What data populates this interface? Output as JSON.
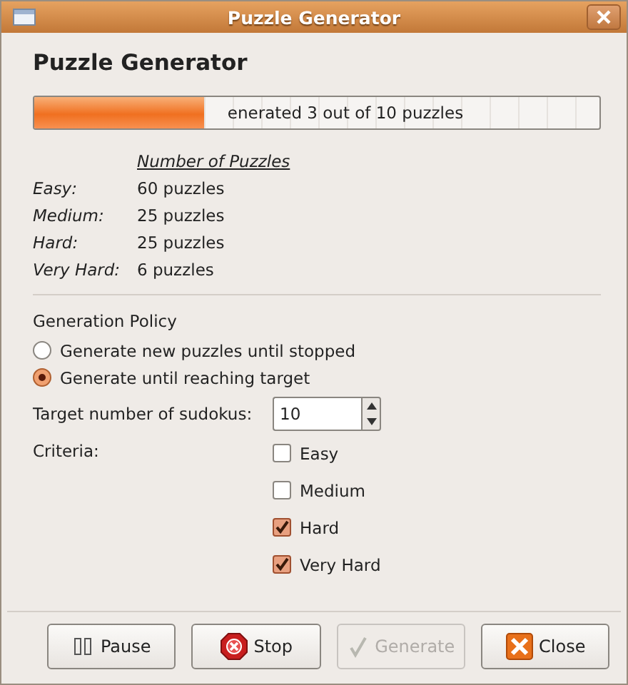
{
  "window": {
    "title": "Puzzle Generator"
  },
  "heading": "Puzzle Generator",
  "progress": {
    "level": 0.3,
    "text": "enerated 3 out of 10 puzzles"
  },
  "counts": {
    "header": "Number of Puzzles",
    "rows": [
      {
        "label": "Easy:",
        "value": "60 puzzles"
      },
      {
        "label": "Medium:",
        "value": "25 puzzles"
      },
      {
        "label": "Hard:",
        "value": "25 puzzles"
      },
      {
        "label": "Very Hard:",
        "value": "6 puzzles"
      }
    ]
  },
  "policy": {
    "title": "Generation Policy",
    "options": [
      {
        "label": "Generate new puzzles until stopped",
        "selected": false
      },
      {
        "label": "Generate until reaching target",
        "selected": true
      }
    ]
  },
  "target": {
    "label": "Target number of sudokus:",
    "value": "10"
  },
  "criteria": {
    "label": "Criteria:",
    "items": [
      {
        "label": "Easy",
        "checked": false
      },
      {
        "label": "Medium",
        "checked": false
      },
      {
        "label": "Hard",
        "checked": true
      },
      {
        "label": "Very Hard",
        "checked": true
      }
    ]
  },
  "buttons": [
    {
      "kind": "pause",
      "label": "Pause",
      "disabled": false
    },
    {
      "kind": "stop",
      "label": "Stop",
      "disabled": false
    },
    {
      "kind": "generate",
      "label": "Generate",
      "disabled": true
    },
    {
      "kind": "close",
      "label": "Close",
      "disabled": false
    }
  ]
}
